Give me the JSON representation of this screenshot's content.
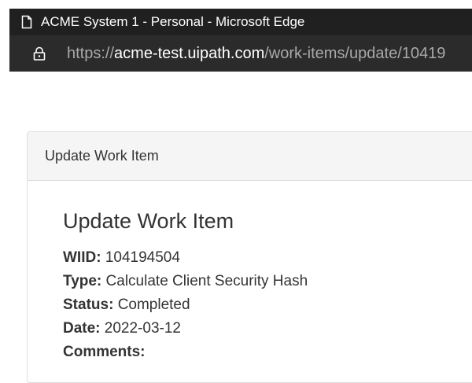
{
  "browser": {
    "window_title": "ACME System 1 - Personal - Microsoft Edge",
    "url_prefix": "https://",
    "url_domain": "acme-test.uipath.com",
    "url_path": "/work-items/update/10419"
  },
  "panel": {
    "heading": "Update Work Item",
    "title": "Update Work Item",
    "fields": [
      {
        "label": "WIID:",
        "value": "104194504"
      },
      {
        "label": "Type:",
        "value": "Calculate Client Security Hash"
      },
      {
        "label": "Status:",
        "value": "Completed"
      },
      {
        "label": "Date:",
        "value": "2022-03-12"
      },
      {
        "label": "Comments:",
        "value": ""
      }
    ]
  },
  "icons": {
    "page": "page-icon",
    "lock": "lock-icon"
  }
}
